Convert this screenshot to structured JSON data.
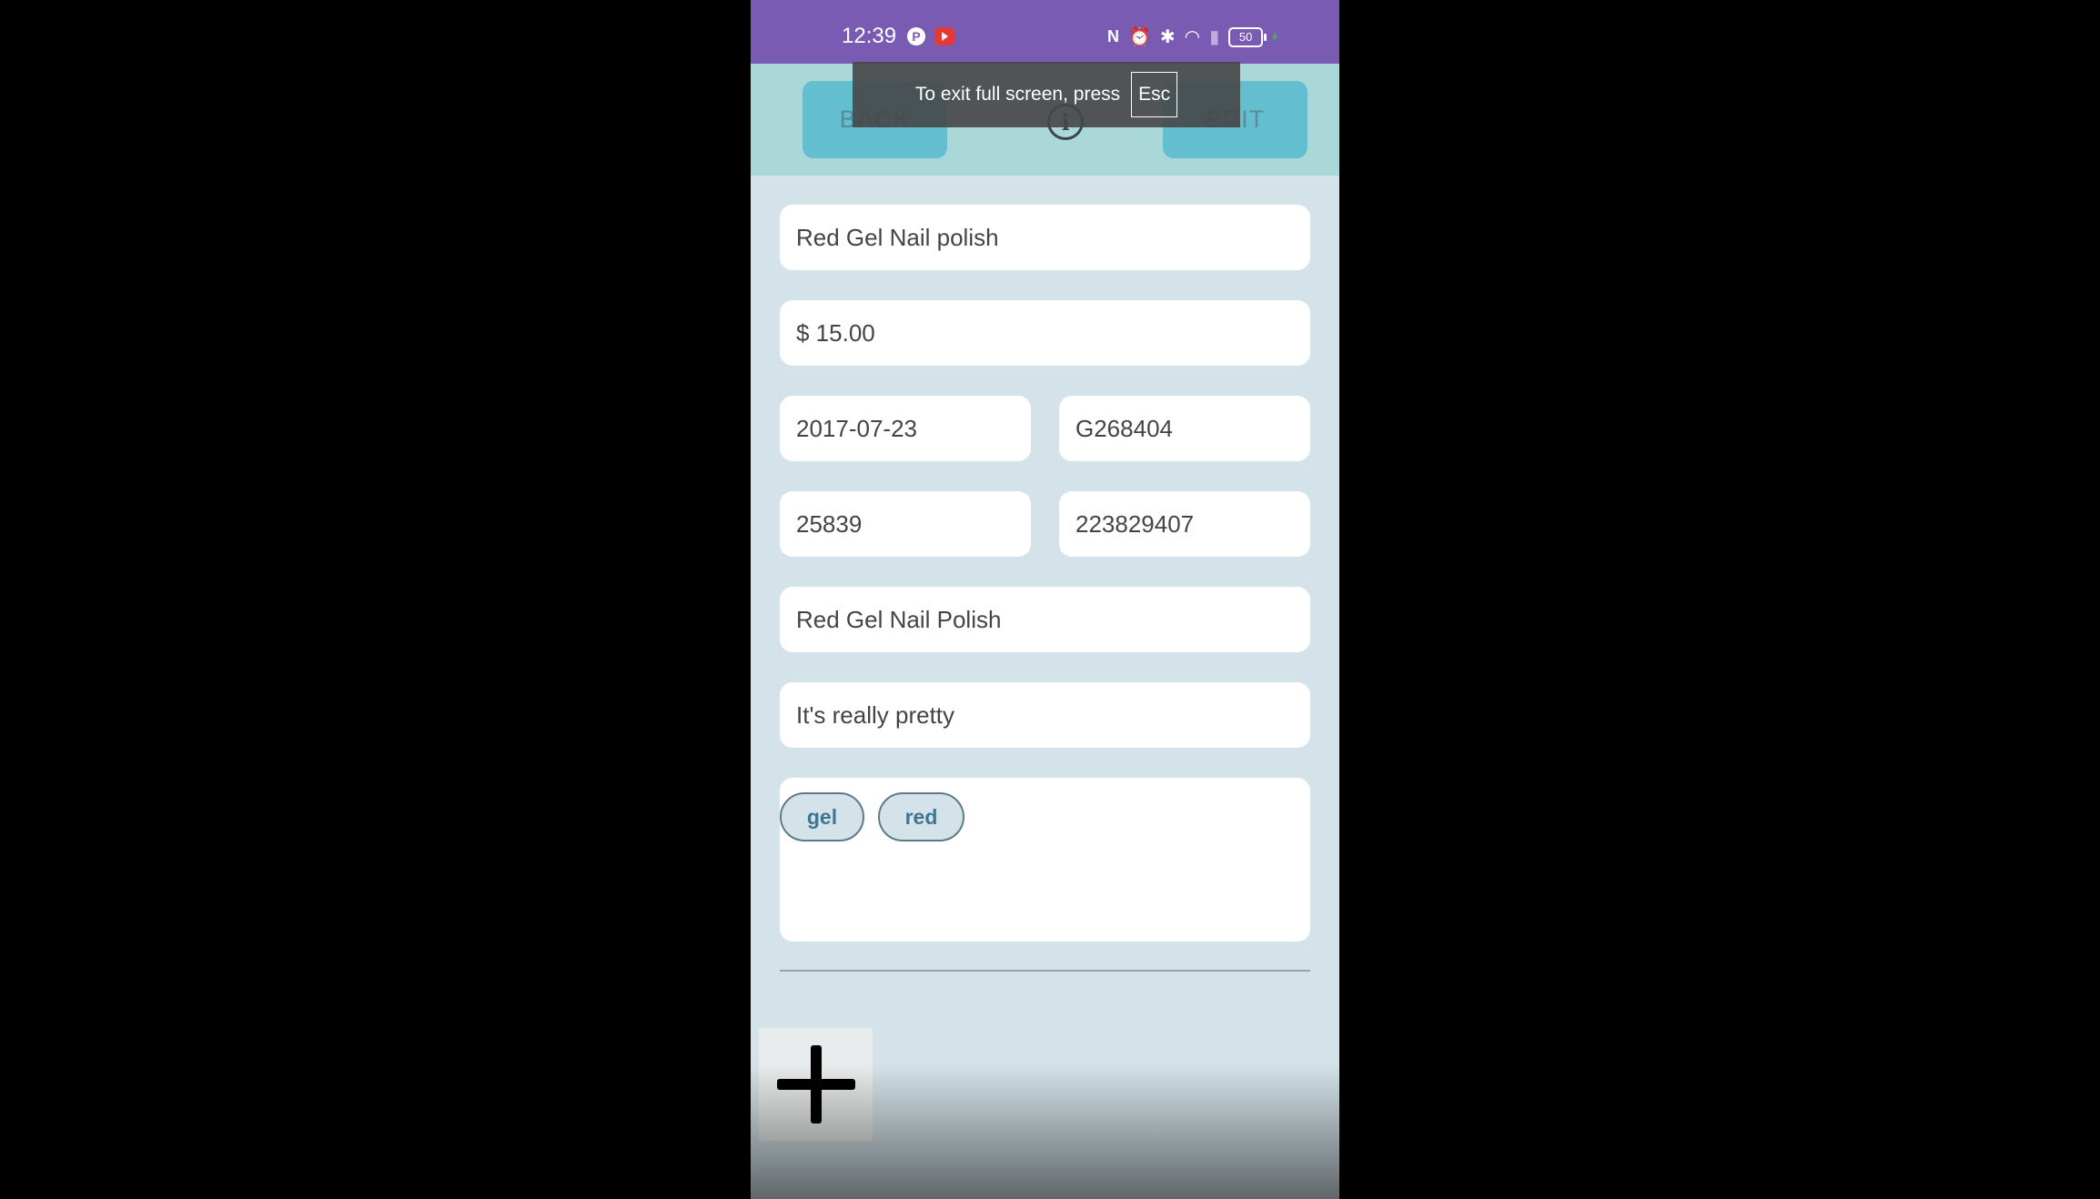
{
  "status_bar": {
    "time": "12:39",
    "battery": "50",
    "icons": [
      "pinterest-icon",
      "youtube-icon",
      "nfc-icon",
      "alarm-icon",
      "bluetooth-icon",
      "wifi-icon",
      "signal-icon",
      "battery-icon",
      "charging-icon"
    ]
  },
  "toolbar": {
    "back_label": "BACK",
    "edit_label": "EDIT",
    "info_glyph": "i"
  },
  "fullscreen_toast": {
    "message": "To exit full screen, press",
    "key": "Esc"
  },
  "item": {
    "name": "Red Gel Nail polish",
    "price": "$ 15.00",
    "date": "2017-07-23",
    "code": "G268404",
    "quantity_id": "25839",
    "number": "223829407",
    "title": "Red Gel Nail Polish",
    "note": "It's really pretty"
  },
  "tags": [
    "gel",
    "red"
  ],
  "colors": {
    "status_bar": "#7a5bb3",
    "toolbar": "#aad7d7",
    "button": "#63bed0",
    "background": "#d4e3e9"
  }
}
